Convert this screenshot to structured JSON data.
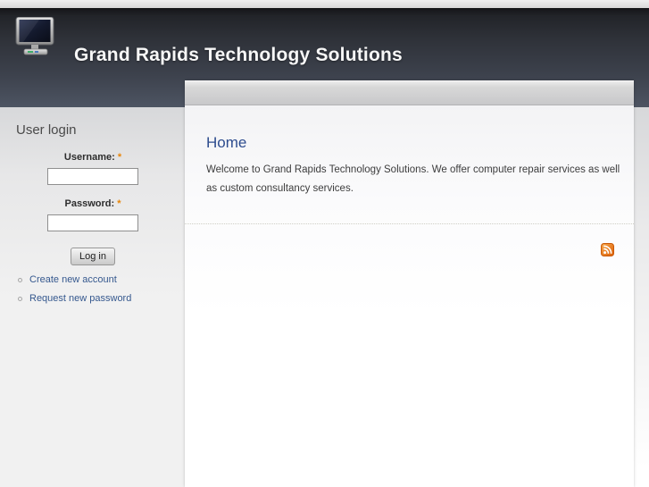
{
  "site": {
    "title": "Grand Rapids Technology Solutions",
    "logo_icon": "computer-monitor-icon"
  },
  "sidebar": {
    "login_block": {
      "title": "User login",
      "username_label": "Username:",
      "username_value": "",
      "password_label": "Password:",
      "password_value": "",
      "required_marker": "*",
      "login_button": "Log in",
      "links": [
        {
          "label": "Create new account"
        },
        {
          "label": "Request new password"
        }
      ]
    }
  },
  "main": {
    "page_title": "Home",
    "body_text": "Welcome to Grand Rapids Technology Solutions. We offer computer repair services as well as custom consultancy services.",
    "rss_icon": "rss-feed-icon"
  },
  "colors": {
    "header_top": "#141518",
    "header_bottom": "#4d5462",
    "page_title_blue": "#2d4c8e",
    "link_blue": "#35588e",
    "required_orange": "#e8860a",
    "rss_orange": "#e2650c"
  }
}
